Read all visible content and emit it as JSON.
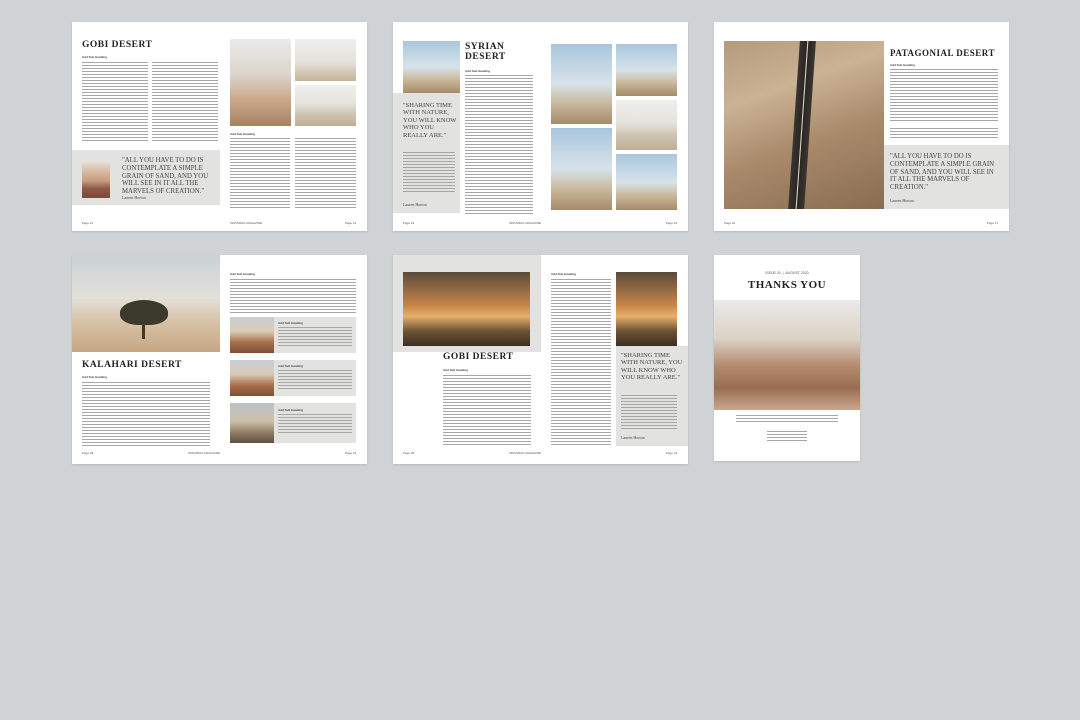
{
  "spread1": {
    "title": "GOBI DESERT",
    "subheading": "Add Sub Heading",
    "subheading2": "Add Sub Heading",
    "quote": "\"ALL YOU HAVE TO DO IS CONTEMPLATE A SIMPLE GRAIN OF SAND, AND YOU WILL SEE IN IT ALL THE MARVELS OF CREATION.\"",
    "author": "Lauren Horton",
    "foot_left": "Page 12",
    "foot_mid": "INSTAMAG MAGAZINE",
    "foot_right": "Page 13"
  },
  "spread2": {
    "title_line1": "SYRIAN",
    "title_line2": "DESERT",
    "quote": "\"SHARING TIME WITH NATURE, YOU WILL KNOW WHO YOU REALLY ARE.\"",
    "subheading": "Add Sub Heading",
    "author": "Lauren Horton",
    "foot_left": "Page 14",
    "foot_mid": "INSTAMAG MAGAZINE",
    "foot_right": "Page 15"
  },
  "spread3": {
    "title": "PATAGONIAL DESERT",
    "subheading": "Add Sub Heading",
    "quote": "\"ALL YOU HAVE TO DO IS CONTEMPLATE A SIMPLE GRAIN OF SAND, AND YOU WILL SEE IN IT ALL THE MARVELS OF CREATION.\"",
    "author": "Lauren Horton",
    "foot_left": "Page 16",
    "foot_right": "Page 17"
  },
  "spread4": {
    "title": "KALAHARI DESERT",
    "subheading": "Add Sub Heading",
    "subheading2": "Add Sub Heading",
    "item_heading": "Add Sub Heading",
    "foot_left": "Page 18",
    "foot_mid": "INSTAMAG MAGAZINE",
    "foot_right": "Page 19"
  },
  "spread5": {
    "title": "GOBI DESERT",
    "subheading": "Add Sub Heading",
    "subheading2": "Add Sub Heading",
    "quote": "\"SHARING TIME WITH NATURE, YOU WILL KNOW WHO YOU REALLY ARE.\"",
    "author": "Lauren Horton",
    "foot_left": "Page 20",
    "foot_mid": "INSTAMAG MAGAZINE",
    "foot_right": "Page 21"
  },
  "back_cover": {
    "issue_line": "ISSUE 20  |  AUGUST 2020",
    "title": "THANKS YOU"
  }
}
